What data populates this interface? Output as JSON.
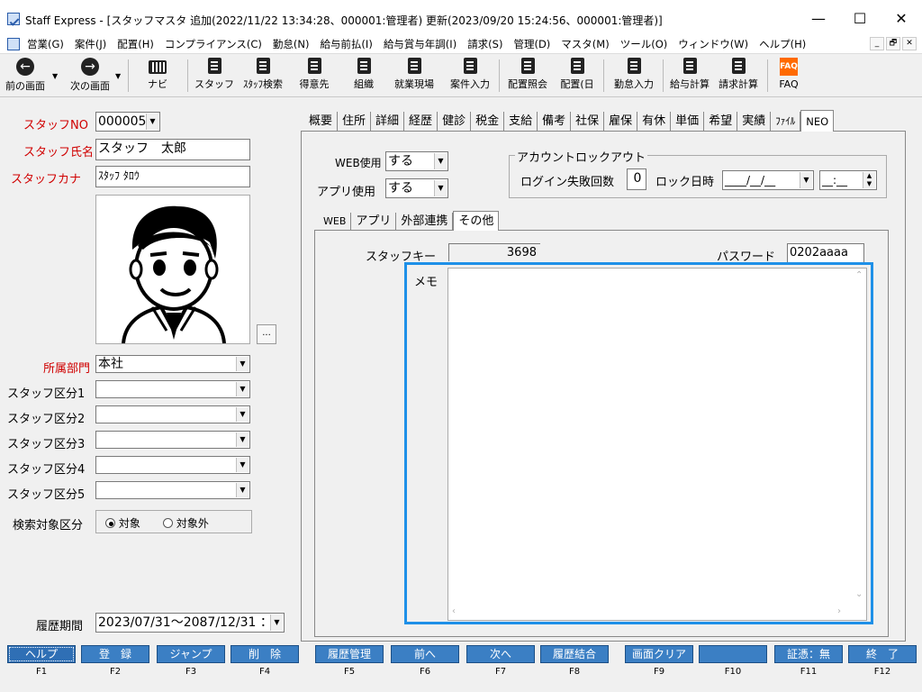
{
  "window": {
    "title": "Staff Express - [スタッフマスタ 追加(2022/11/22 13:34:28、000001:管理者) 更新(2023/09/20 15:24:56、000001:管理者)]",
    "controls": {
      "minimize": "—",
      "maximize": "☐",
      "close": "✕"
    }
  },
  "menu": {
    "items": [
      "営業(G)",
      "案件(J)",
      "配置(H)",
      "コンプライアンス(C)",
      "勤怠(N)",
      "給与前払(I)",
      "給与賞与年調(I)",
      "請求(S)",
      "管理(D)",
      "マスタ(M)",
      "ツール(O)",
      "ウィンドウ(W)",
      "ヘルプ(H)"
    ],
    "mdi": [
      "_",
      "🗗",
      "✕"
    ]
  },
  "toolbar": {
    "prev": "前の画面",
    "next": "次の画面",
    "navi": "ナビ",
    "staff": "スタッフ",
    "staff_search": "ｽﾀｯﾌ検索",
    "customer": "得意先",
    "org": "組織",
    "worksite": "就業現場",
    "case_input": "案件入力",
    "placement_inquiry": "配置照会",
    "placement_day": "配置(日",
    "attendance_input": "勤怠入力",
    "payroll_calc": "給与計算",
    "billing_calc": "請求計算",
    "faq": "FAQ",
    "faq_icon_text": "FAQ"
  },
  "left": {
    "staff_no_label": "スタッフNO",
    "staff_no_value": "000005",
    "staff_name_label": "スタッフ氏名",
    "staff_name_value": "スタッフ　太郎",
    "staff_kana_label": "スタッフカナ",
    "staff_kana_value": "ｽﾀｯﾌ ﾀﾛｳ",
    "photo_button": "...",
    "dept_label": "所属部門",
    "dept_value": "本社",
    "category1_label": "スタッフ区分1",
    "category2_label": "スタッフ区分2",
    "category3_label": "スタッフ区分3",
    "category4_label": "スタッフ区分4",
    "category5_label": "スタッフ区分5",
    "search_target_label": "検索対象区分",
    "search_target_on": "対象",
    "search_target_off": "対象外",
    "history_label": "履歴期間",
    "history_value": "2023/07/31～2087/12/31 ："
  },
  "tabs_main": [
    "概要",
    "住所",
    "詳細",
    "経歴",
    "健診",
    "税金",
    "支給",
    "備考",
    "社保",
    "雇保",
    "有休",
    "単価",
    "希望",
    "実績",
    "ﾌｧｲﾙ",
    "NEO"
  ],
  "neo": {
    "web_use_label": "WEB使用",
    "web_use_value": "する",
    "app_use_label": "アプリ使用",
    "app_use_value": "する",
    "lockout_title": "アカウントロックアウト",
    "login_fail_label": "ログイン失敗回数",
    "login_fail_value": "0",
    "lock_date_label": "ロック日時",
    "lock_date_value": "____/__/__",
    "lock_time_value": "__:__"
  },
  "tabs_sub": [
    "WEB",
    "アプリ",
    "外部連携",
    "その他"
  ],
  "other": {
    "staff_key_label": "スタッフキー",
    "staff_key_value": "3698",
    "password_label": "パスワード",
    "password_value": "0202aaaa",
    "memo_label": "メモ",
    "memo_value": ""
  },
  "fkeys": [
    {
      "label": "ヘルプ",
      "key": "F1"
    },
    {
      "label": "登　録",
      "key": "F2"
    },
    {
      "label": "ジャンプ",
      "key": "F3"
    },
    {
      "label": "削　除",
      "key": "F4"
    },
    {
      "label": "履歴管理",
      "key": "F5"
    },
    {
      "label": "前へ",
      "key": "F6"
    },
    {
      "label": "次へ",
      "key": "F7"
    },
    {
      "label": "履歴結合",
      "key": "F8"
    },
    {
      "label": "画面クリア",
      "key": "F9"
    },
    {
      "label": "",
      "key": "F10"
    },
    {
      "label": "証憑：無",
      "key": "F11"
    },
    {
      "label": "終　了",
      "key": "F12"
    }
  ]
}
